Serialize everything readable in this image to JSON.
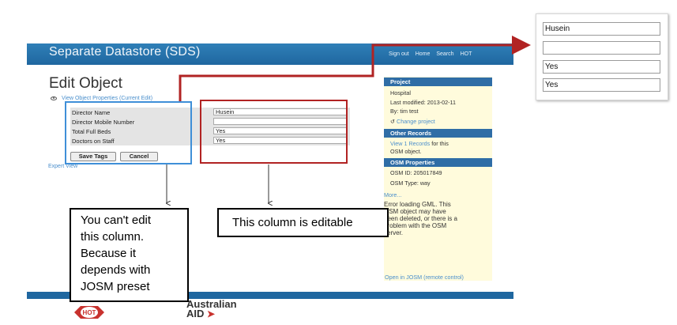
{
  "header": {
    "app_title": "Separate Datastore (SDS)",
    "nav": [
      "Sign out",
      "Home",
      "Search",
      "HOT"
    ]
  },
  "page": {
    "title": "Edit Object",
    "subline": "View Object Properties (Current Edit)"
  },
  "tags": {
    "rows": [
      {
        "key": "Director Name",
        "value": "Husein"
      },
      {
        "key": "Director Mobile Number",
        "value": ""
      },
      {
        "key": "Total Full Beds",
        "value": "Yes"
      },
      {
        "key": "Doctors on Staff",
        "value": "Yes"
      }
    ],
    "save_label": "Save Tags",
    "cancel_label": "Cancel",
    "expert_view": "Expert View"
  },
  "sidebar": {
    "project_head": "Project",
    "project_name": "Hospital",
    "last_modified": "Last modified: 2013-02-11",
    "by": "By: tim test",
    "change_project": "Change project",
    "other_head": "Other Records",
    "view_records_link": "View 1 Records",
    "view_records_rest": " for this",
    "osm_object": "OSM object.",
    "osm_head": "OSM Properties",
    "osm_id": "OSM ID: 205017849",
    "osm_type": "OSM Type: way",
    "more": "More...",
    "error_lines": [
      "Error loading GML. This",
      "OSM object may have",
      "been deleted, or there is a",
      "problem with the OSM",
      "server."
    ],
    "open_josm": "Open in JOSM (remote control)"
  },
  "footer": {
    "aus_logo_line1": "Australian",
    "aus_logo_line2": "AID",
    "hot_logo": "HOT"
  },
  "annotations": {
    "left_note_lines": [
      "You can't edit",
      "this column.",
      "Because it",
      "depends with",
      "JOSM preset"
    ],
    "right_note": "This column is editable"
  },
  "zoom_panel": {
    "values": [
      "Husein",
      "",
      "Yes",
      "Yes"
    ]
  },
  "colors": {
    "brand_blue": "#1f67a0",
    "annotation_red": "#b12323",
    "annotation_blue": "#3f8fd8",
    "panel_yellow": "#fffbdc"
  }
}
